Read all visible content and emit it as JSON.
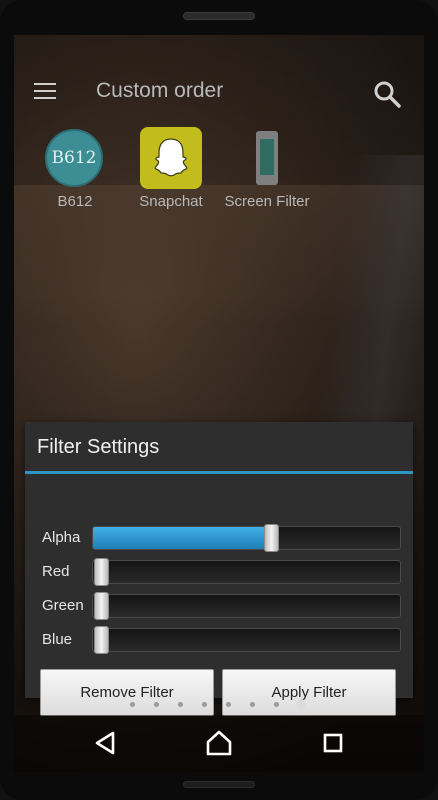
{
  "app_bar": {
    "title": "Custom order",
    "menu_icon": "hamburger-menu-icon",
    "search_icon": "search-icon"
  },
  "apps": [
    {
      "label": "B612",
      "icon": "b612-app-icon",
      "icon_text": "B612",
      "color": "#3d8d95"
    },
    {
      "label": "Snapchat",
      "icon": "snapchat-ghost-icon",
      "color": "#c2bd1d"
    },
    {
      "label": "Screen Filter",
      "icon": "screen-filter-app-icon",
      "color": "#7f7f7f"
    }
  ],
  "dialog": {
    "title": "Filter Settings",
    "accent_color": "#2c95c4",
    "sliders": [
      {
        "label": "Alpha",
        "value": 0.58
      },
      {
        "label": "Red",
        "value": 0.0
      },
      {
        "label": "Green",
        "value": 0.0
      },
      {
        "label": "Blue",
        "value": 0.0
      }
    ],
    "buttons": {
      "remove": "Remove Filter",
      "apply": "Apply Filter"
    }
  },
  "page_indicator": {
    "count": 8,
    "active_index": 7
  },
  "nav_bar": {
    "back_icon": "back-triangle-icon",
    "home_icon": "home-icon",
    "recents_icon": "recents-square-icon"
  }
}
